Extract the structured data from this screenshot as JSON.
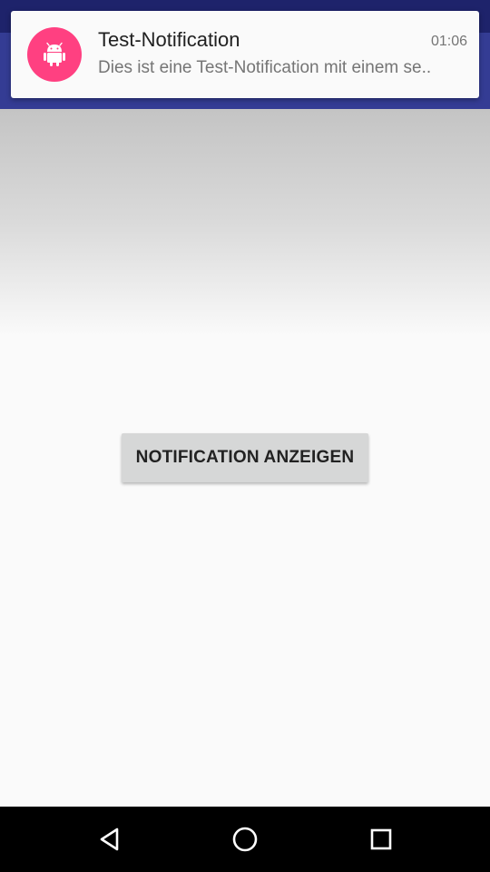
{
  "notification": {
    "title": "Test-Notification",
    "time": "01:06",
    "text": "Dies ist eine Test-Notification mit einem se..",
    "icon": "android-icon",
    "icon_bg": "#ff4081"
  },
  "main": {
    "button_label": "NOTIFICATION ANZEIGEN"
  },
  "navbar": {
    "back_icon": "back-icon",
    "home_icon": "home-icon",
    "recents_icon": "recents-icon"
  },
  "colors": {
    "toolbar": "#343c94",
    "status_bar": "#1e236b",
    "background": "#fafafa"
  }
}
